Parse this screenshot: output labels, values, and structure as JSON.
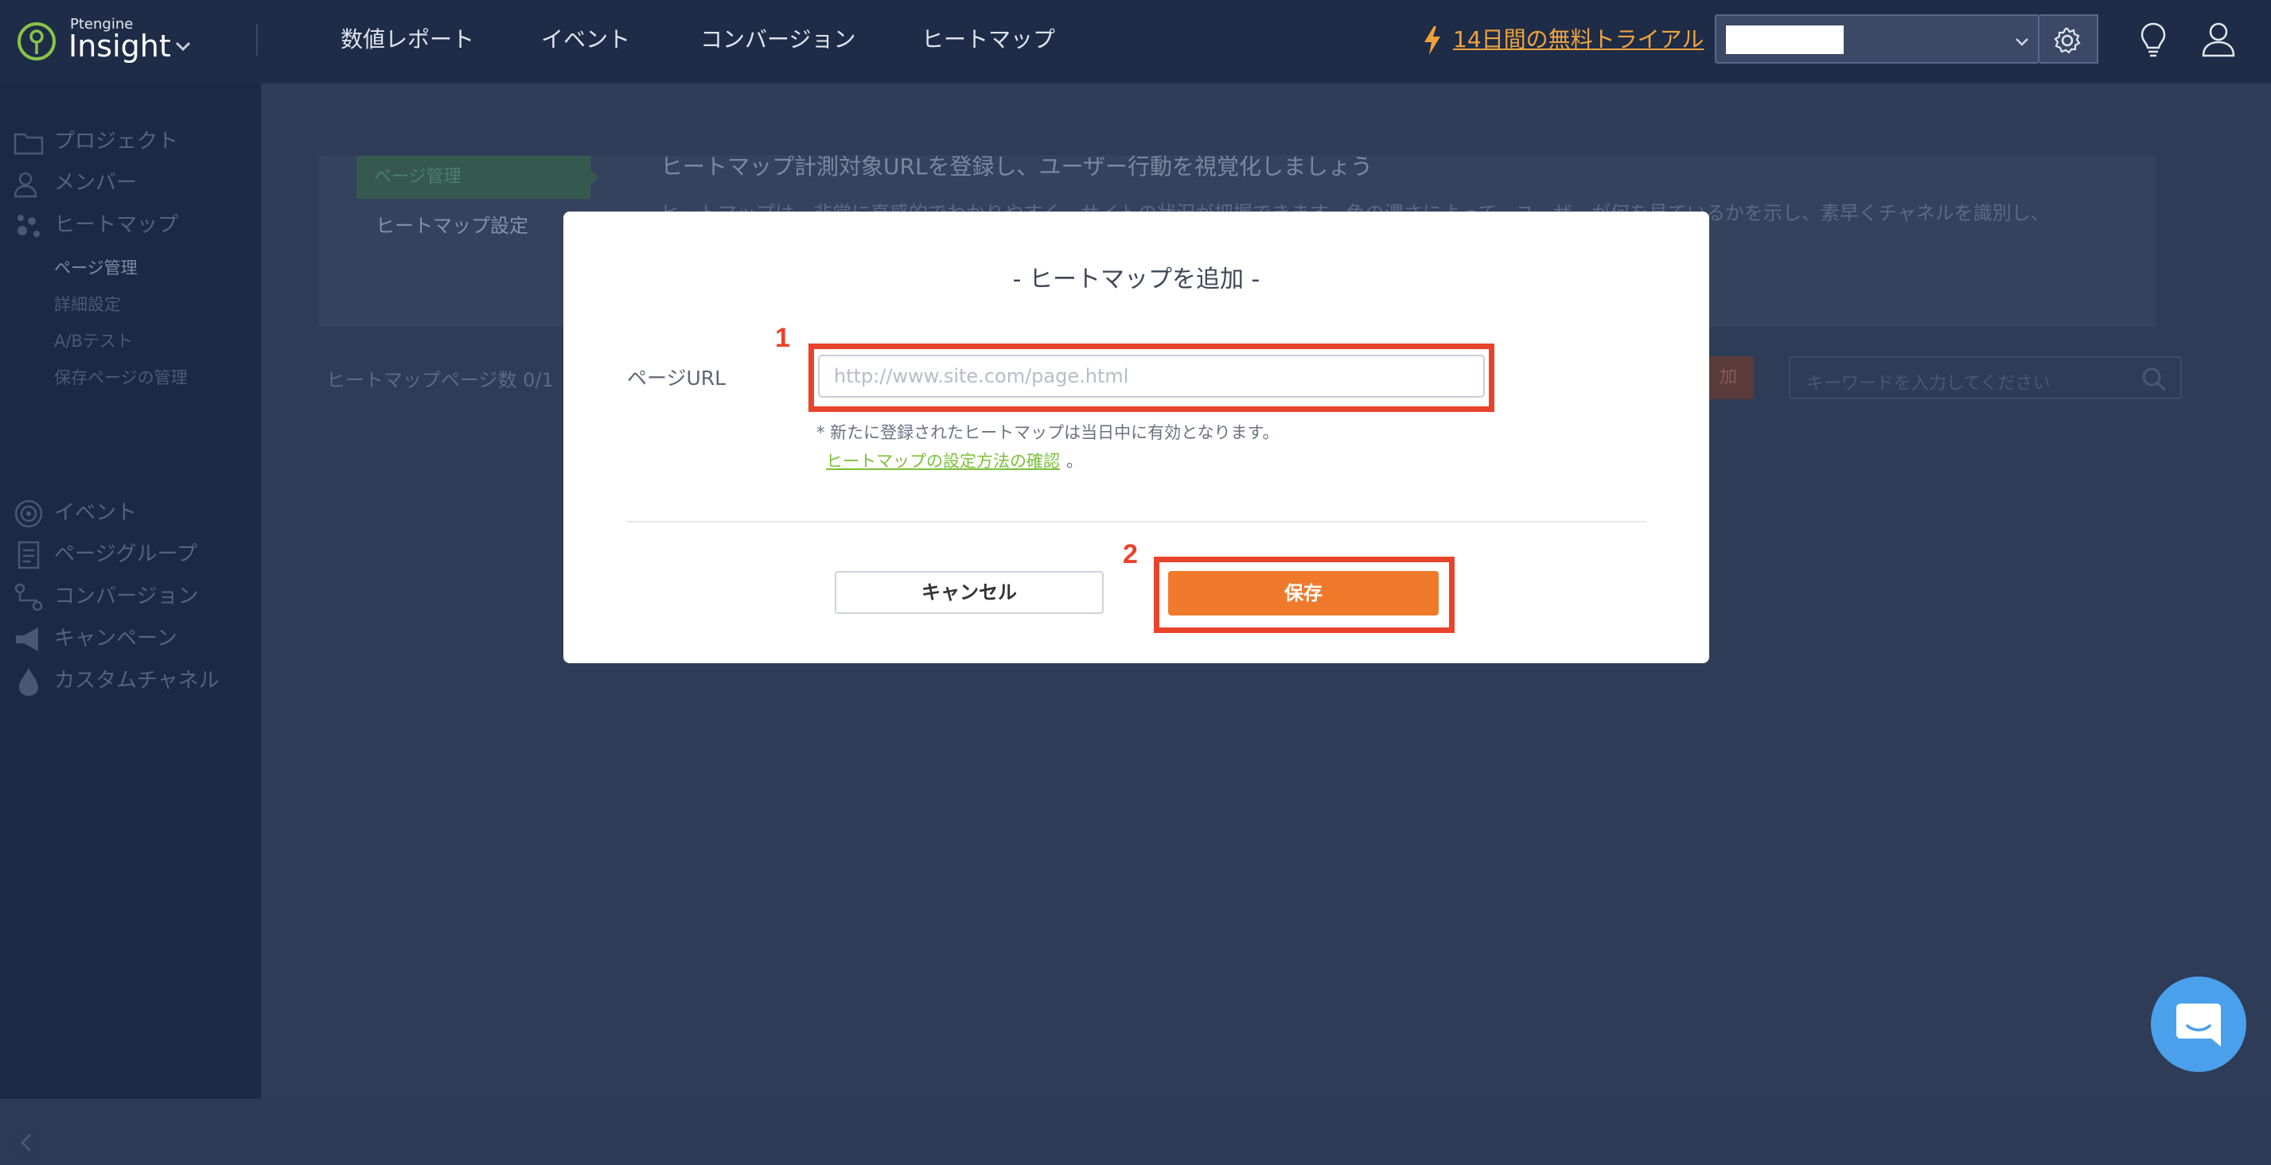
{
  "brand": {
    "small": "Ptengine",
    "name": "Insight"
  },
  "topnav": [
    {
      "label": "数値レポート"
    },
    {
      "label": "イベント"
    },
    {
      "label": "コンバージョン"
    },
    {
      "label": "ヒートマップ"
    }
  ],
  "trial_label": "14日間の無料トライアル",
  "sidebar": {
    "items": [
      {
        "label": "プロジェクト",
        "icon": "folder-icon"
      },
      {
        "label": "メンバー",
        "icon": "members-icon"
      },
      {
        "label": "ヒートマップ",
        "icon": "heatmap-icon"
      },
      {
        "label": "イベント",
        "icon": "event-icon"
      },
      {
        "label": "ページグループ",
        "icon": "page-group-icon"
      },
      {
        "label": "コンバージョン",
        "icon": "conversion-icon"
      },
      {
        "label": "キャンペーン",
        "icon": "megaphone-icon"
      },
      {
        "label": "カスタムチャネル",
        "icon": "drop-icon"
      }
    ],
    "heatmap_sub": [
      "ページ管理",
      "詳細設定",
      "A/Bテスト",
      "保存ページの管理"
    ]
  },
  "main": {
    "tab_active": "ページ管理",
    "tab_other": "ヒートマップ設定",
    "desc_title": "ヒートマップ計測対象URLを登録し、ユーザー行動を視覚化しましょう",
    "desc_body": "ヒートマップは、非常に直感的でわかりやすく、サイトの状況が把握できます。色の濃さによって、ユーザーが何を見ているかを示し、素早くチャネルを識別し、",
    "count_label": "ヒートマップページ数 0/1",
    "add_button": "加",
    "search_placeholder": "キーワードを入力してください"
  },
  "modal": {
    "title": "- ヒートマップを追加 -",
    "url_label": "ページURL",
    "url_placeholder": "http://www.site.com/page.html",
    "note": "* 新たに登録されたヒートマップは当日中に有効となります。",
    "help_link": "ヒートマップの設定方法の確認",
    "help_suffix": "。",
    "cancel": "キャンセル",
    "save": "保存",
    "marker1": "1",
    "marker2": "2"
  },
  "colors": {
    "topbar": "#1e2c47",
    "sidebar": "#1c2944",
    "accent_orange": "#f07a2c",
    "highlight_red": "#e8432c",
    "link_green": "#7cbf3a",
    "trial_orange": "#f0a33c",
    "chat_blue": "#4aa0ea"
  }
}
